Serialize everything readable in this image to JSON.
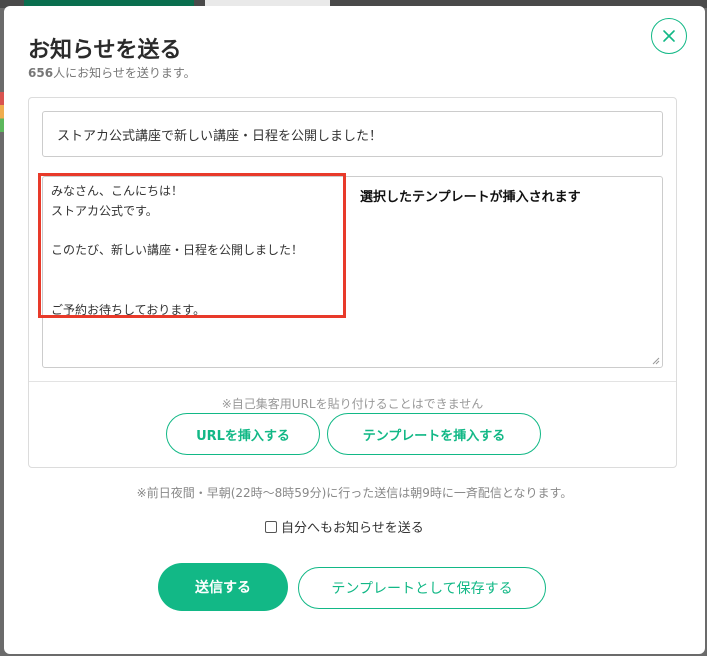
{
  "modal": {
    "title": "お知らせを送る",
    "recipient_count": "656",
    "recipient_suffix": "人にお知らせを送ります。"
  },
  "form": {
    "subject_value": "ストアカ公式講座で新しい講座・日程を公開しました！",
    "body_value": "みなさん、こんにちは！\nストアカ公式です。\n\nこのたび、新しい講座・日程を公開しました！\n\n\nご予約お待ちしております。",
    "url_restriction_note": "※自己集客用URLを貼り付けることはできません",
    "insert_url_label": "URLを挿入する",
    "insert_template_label": "テンプレートを挿入する"
  },
  "delivery_note": "※前日夜間・早朝(22時〜8時59分)に行った送信は朝9時に一斉配信となります。",
  "self_notify": {
    "label": "自分へもお知らせを送る",
    "checked": false
  },
  "actions": {
    "send_label": "送信する",
    "save_template_label": "テンプレートとして保存する"
  },
  "annotation": {
    "text": "選択したテンプレートが挿入されます"
  },
  "icons": {
    "close": "close-icon",
    "resize": "resize-grip-icon"
  },
  "colors": {
    "accent": "#12b886",
    "highlight": "#e83a2a",
    "overlay": "#6b6b6b"
  }
}
